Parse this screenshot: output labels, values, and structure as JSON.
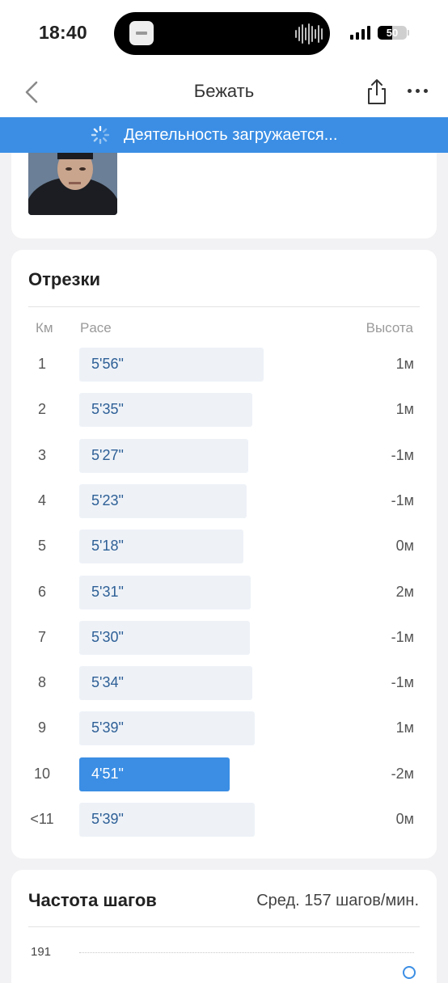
{
  "status_bar": {
    "time": "18:40",
    "battery": "50",
    "battery_level": 0.5
  },
  "nav": {
    "title": "Бежать"
  },
  "banner": {
    "text": "Деятельность загружается..."
  },
  "splits": {
    "title": "Отрезки",
    "headers": {
      "km": "Км",
      "pace": "Pace",
      "elevation": "Высота"
    },
    "rows": [
      {
        "km": "1",
        "pace": "5'56\"",
        "elevation": "1м",
        "pace_seconds": 356,
        "best": false
      },
      {
        "km": "2",
        "pace": "5'35\"",
        "elevation": "1м",
        "pace_seconds": 335,
        "best": false
      },
      {
        "km": "3",
        "pace": "5'27\"",
        "elevation": "-1м",
        "pace_seconds": 327,
        "best": false
      },
      {
        "km": "4",
        "pace": "5'23\"",
        "elevation": "-1м",
        "pace_seconds": 323,
        "best": false
      },
      {
        "km": "5",
        "pace": "5'18\"",
        "elevation": "0м",
        "pace_seconds": 318,
        "best": false
      },
      {
        "km": "6",
        "pace": "5'31\"",
        "elevation": "2м",
        "pace_seconds": 331,
        "best": false
      },
      {
        "km": "7",
        "pace": "5'30\"",
        "elevation": "-1м",
        "pace_seconds": 330,
        "best": false
      },
      {
        "km": "8",
        "pace": "5'34\"",
        "elevation": "-1м",
        "pace_seconds": 334,
        "best": false
      },
      {
        "km": "9",
        "pace": "5'39\"",
        "elevation": "1м",
        "pace_seconds": 339,
        "best": false
      },
      {
        "km": "10",
        "pace": "4'51\"",
        "elevation": "-2м",
        "pace_seconds": 291,
        "best": true
      },
      {
        "km": "<11",
        "pace": "5'39\"",
        "elevation": "0м",
        "pace_seconds": 339,
        "best": false
      }
    ]
  },
  "cadence": {
    "title": "Частота шагов",
    "average": "Сред. 157 шагов/мин.",
    "axis_top": "191"
  },
  "colors": {
    "accent": "#3b8ee4",
    "bar_bg": "#eef2f7",
    "pace_text": "#2d5f96"
  },
  "icons": {
    "back": "chevron-left-icon",
    "share": "share-icon",
    "more": "more-icon",
    "spinner": "spinner-icon"
  }
}
